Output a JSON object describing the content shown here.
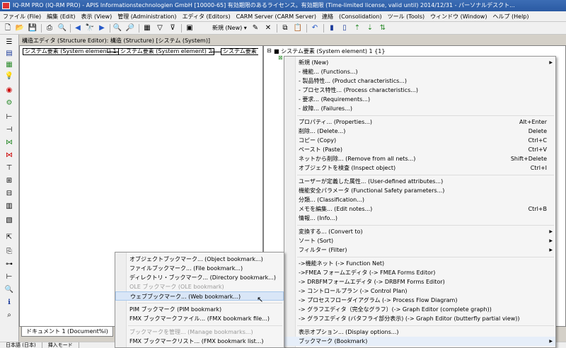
{
  "window": {
    "title": "IQ-RM PRO (IQ-RM PRO) - APIS Informationstechnologien GmbH [10000-65] 有効期限のあるライセンス。有効期限 (Time-limited license, valid until) 2014/12/31 - パーソナルデスクト..."
  },
  "menubar": [
    "ファイル (File)",
    "編集 (Edit)",
    "表示 (View)",
    "管理 (Administration)",
    "エディタ (Editors)",
    "CARM Server (CARM Server)",
    "連絡",
    "(Consolidation)",
    "ツール (Tools)",
    "ウィンドウ (Window)",
    "ヘルプ (Help)"
  ],
  "toolbar": {
    "new_label": "新規 (New)"
  },
  "pane": {
    "header": "構造エディタ (Structure Editor): 構造 (Structure) [システム (System)]"
  },
  "structure": {
    "nodes": [
      "システム要素 (System element) 1",
      "システム要素 (System element) 2",
      "システム要素"
    ]
  },
  "right_tree": {
    "root": "システム要素 (System element) 1 {1}"
  },
  "doc_tab": "ドキュメント 1 (Document%i)",
  "status": {
    "lang": "日本語 (日本)",
    "mode": "挿入モード"
  },
  "context_menu": {
    "new": "新規 (New)",
    "functions": "- 機能... (Functions...)",
    "product_chars": "- 製品特性... (Product characteristics...)",
    "process_chars": "- プロセス特性... (Process characteristics...)",
    "requirements": "- 要求... (Requirements...)",
    "failures": "- 故障... (Failures...)",
    "properties": "プロパティ... (Properties...)",
    "properties_sc": "Alt+Enter",
    "delete": "削除... (Delete...)",
    "delete_sc": "Delete",
    "copy": "コピー (Copy)",
    "copy_sc": "Ctrl+C",
    "paste": "ペースト (Paste)",
    "paste_sc": "Ctrl+V",
    "remove_nets": "ネットから削除... (Remove from all nets...)",
    "remove_nets_sc": "Shift+Delete",
    "inspect": "オブジェクトを検査 (Inspect object)",
    "inspect_sc": "Ctrl+I",
    "user_attrs": "ユーザーが定義した属性... (User-defined attributes...)",
    "func_safety": "機能安全パラメータ (Functional Safety parameters...)",
    "classification": "分類... (Classification...)",
    "edit_notes": "メモを編集... (Edit notes...)",
    "edit_notes_sc": "Ctrl+B",
    "info": "情報... (Info...)",
    "convert": "変換する... (Convert to)",
    "sort": "ソート (Sort)",
    "filter": "フィルター (Filter)",
    "function_net": "->機能ネット (-> Function Net)",
    "fmea_forms": "->FMEA フォームエディタ (-> FMEA Forms Editor)",
    "drbfm_forms": "-> DRBFMフォームエディタ (-> DRBFM Forms Editor)",
    "control_plan": "-> コントロールプラン (-> Control Plan)",
    "process_flow": "-> プロセスフローダイアグラム (-> Process Flow Diagram)",
    "graph_complete": "-> グラフエディタ（完全なグラフ）(-> Graph Editor (complete graph))",
    "graph_butterfly": "-> グラフエディタ (バタフライ部分表示) (-> Graph Editor (butterfly partial view))",
    "display_options": "表示オプション... (Display options...)",
    "bookmark": "ブックマーク (Bookmark)"
  },
  "bookmark_menu": {
    "object": "オブジェクトブックマーク... (Object bookmark...)",
    "file": "ファイルブックマーク... (File bookmark...)",
    "directory": "ディレクトリ・ブックマーク... (Directory bookmark...)",
    "ole": "OLE ブックマーク (OLE bookmark)",
    "web": "ウェブブックマーク... (Web bookmark...)",
    "pim": "PIM ブックマーク (PIM bookmark)",
    "fmx_file": "FMX ブックマークファイル... (FMX bookmark file...)",
    "manage": "ブックマークを管理... (Manage bookmarks...)",
    "fmx_list": "FMX ブックマークリスト... (FMX bookmark list...)"
  }
}
